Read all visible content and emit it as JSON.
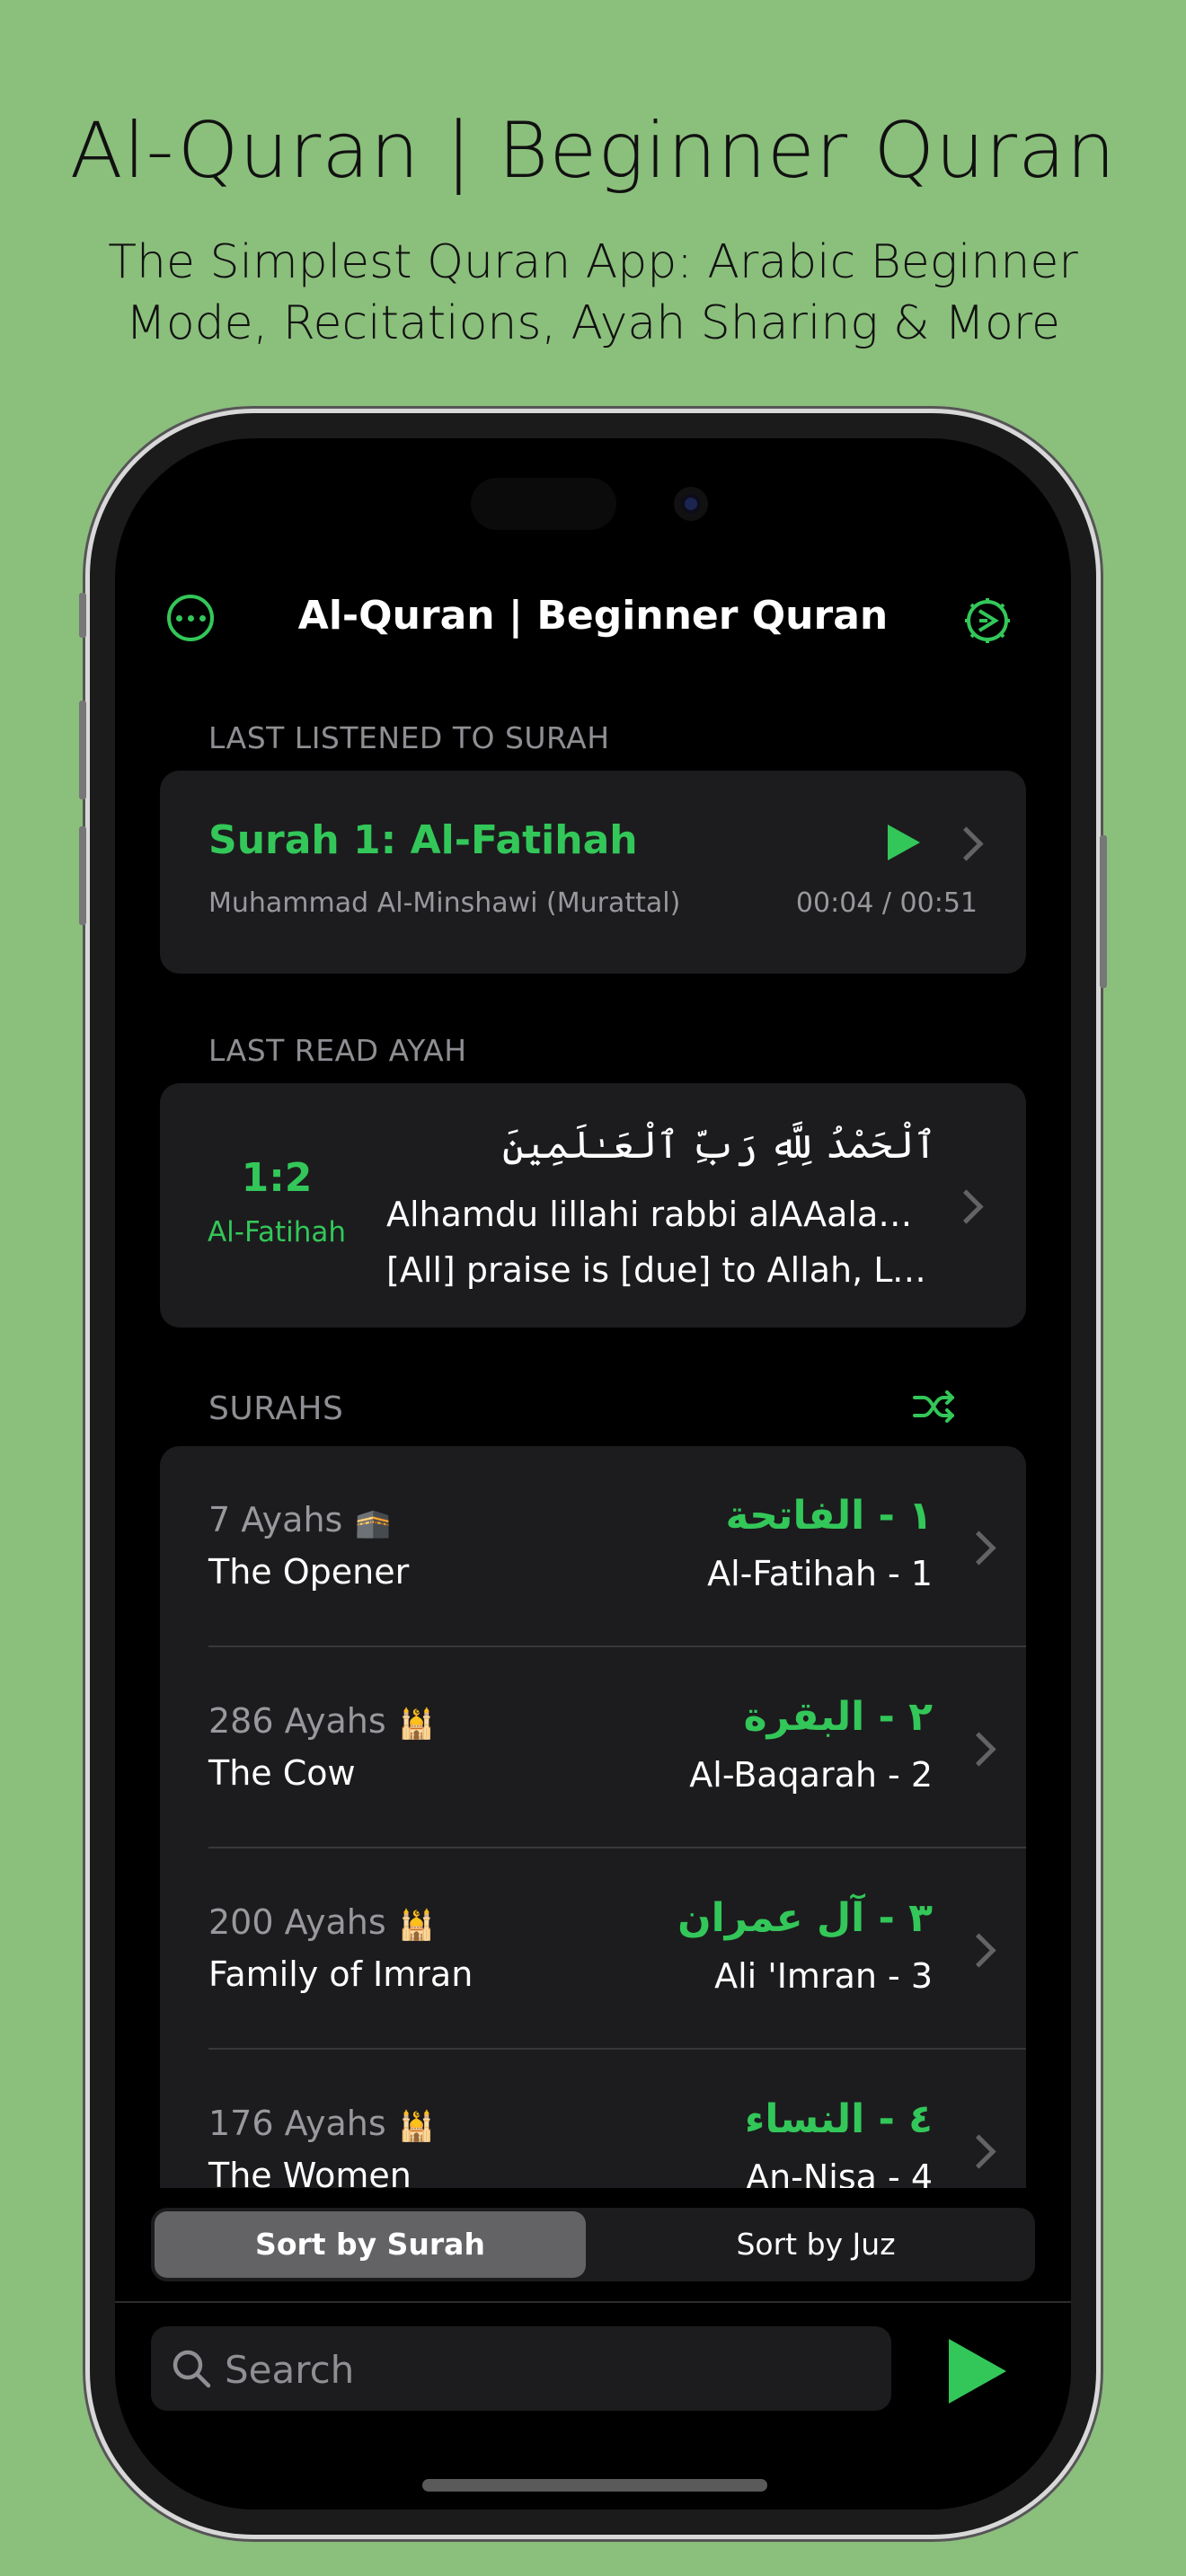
{
  "promo": {
    "title": "Al-Quran | Beginner Quran",
    "subtitle": "The Simplest Quran App: Arabic Beginner Mode, Recitations, Ayah Sharing & More"
  },
  "nav": {
    "title": "Al-Quran | Beginner Quran",
    "left_icon": "more-ellipsis-icon",
    "right_icon": "settings-gear-icon"
  },
  "last_listened": {
    "header": "LAST LISTENED TO SURAH",
    "title": "Surah 1: Al-Fatihah",
    "reciter": "Muhammad Al-Minshawi (Murattal)",
    "time": "00:04 / 00:51"
  },
  "last_read": {
    "header": "LAST READ AYAH",
    "number": "1:2",
    "surah_name": "Al-Fatihah",
    "arabic": "ٱلْحَمْدُ لِلَّهِ رَبِّ ٱلْعَـٰلَمِينَ",
    "transliteration": "Alhamdu lillahi rabbi alAAalameena",
    "translation": "[All] praise is [due] to Allah, Lord of the worlds"
  },
  "surahs": {
    "header": "SURAHS",
    "items": [
      {
        "ayahs": "7 Ayahs",
        "emoji": "🕋",
        "english": "The Opener",
        "arabic": "١ - الفاتحة",
        "translit": "Al-Fatihah - 1"
      },
      {
        "ayahs": "286 Ayahs",
        "emoji": "🕌",
        "english": "The Cow",
        "arabic": "٢ - البقرة",
        "translit": "Al-Baqarah - 2"
      },
      {
        "ayahs": "200 Ayahs",
        "emoji": "🕌",
        "english": "Family of Imran",
        "arabic": "٣ - آل عمران",
        "translit": "Ali 'Imran - 3"
      },
      {
        "ayahs": "176 Ayahs",
        "emoji": "🕌",
        "english": "The Women",
        "arabic": "٤ - النساء",
        "translit": "An-Nisa - 4"
      }
    ]
  },
  "sort": {
    "by_surah": "Sort by Surah",
    "by_juz": "Sort by Juz",
    "selected": "Sort by Surah"
  },
  "search": {
    "placeholder": "Search"
  },
  "colors": {
    "accent": "#33c759",
    "background": "#8bbf7c"
  }
}
